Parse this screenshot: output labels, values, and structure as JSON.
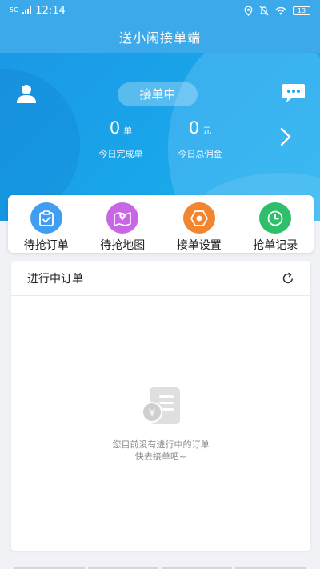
{
  "status_bar": {
    "time": "12:14",
    "network": "5G",
    "battery": "13"
  },
  "header": {
    "title": "送小闲接单端"
  },
  "hero": {
    "status_label": "接单中",
    "orders_today": {
      "value": "0",
      "unit": "单",
      "label": "今日完成单"
    },
    "commission_today": {
      "value": "0",
      "unit": "元",
      "label": "今日总佣金"
    }
  },
  "quick_menu": [
    {
      "label": "待抢订单",
      "icon": "clipboard-check-icon",
      "color": "#3f9ef2"
    },
    {
      "label": "待抢地图",
      "icon": "map-pin-icon",
      "color": "#c867e6"
    },
    {
      "label": "接单设置",
      "icon": "settings-hexagon-icon",
      "color": "#f4852f"
    },
    {
      "label": "抢单记录",
      "icon": "clock-icon",
      "color": "#2fbf6a"
    }
  ],
  "orders_panel": {
    "title": "进行中订单",
    "empty_line1": "您目前没有进行中的订单",
    "empty_line2": "快去接单吧~"
  },
  "colors": {
    "primary": "#3ba9ea",
    "background": "#f1f2f5"
  }
}
